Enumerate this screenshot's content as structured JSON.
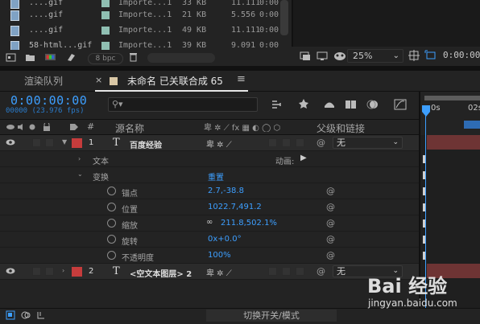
{
  "project": {
    "files": [
      {
        "name": "....gif",
        "type": "Importe...1",
        "size": "33 KB",
        "duration": "11.111",
        "extra": "0:00"
      },
      {
        "name": "....gif",
        "type": "Importe...1",
        "size": "21 KB",
        "duration": "5.556",
        "extra": "0:00"
      },
      {
        "name": "....gif",
        "type": "Importe...1",
        "size": "49 KB",
        "duration": "11.111",
        "extra": "0:00"
      },
      {
        "name": "58-html...gif",
        "type": "Importe...1",
        "size": "39 KB",
        "duration": "9.091",
        "extra": "0:00"
      }
    ],
    "bpc": "8 bpc"
  },
  "viewer": {
    "zoom": "25%",
    "time": "0:00:00:"
  },
  "tabs": {
    "render_queue": "渲染队列",
    "comp_name": "未命名 已关联合成 65"
  },
  "controls": {
    "timecode": "0:00:00:00",
    "fps": "00000 (23.976 fps)"
  },
  "header": {
    "index": "#",
    "source_name": "源名称",
    "parent": "父级和链接"
  },
  "layers": [
    {
      "index": "1",
      "type_glyph": "T",
      "name": "百度经验",
      "parent": "无"
    },
    {
      "index": "2",
      "type_glyph": "T",
      "name": "<空文本图层> 2",
      "parent": "无"
    }
  ],
  "props": {
    "text": "文本",
    "animate": "动画:",
    "transform": "变换",
    "reset": "重置",
    "anchor": {
      "label": "锚点",
      "value": "2.7,-38.8"
    },
    "position": {
      "label": "位置",
      "value": "1022.7,491.2"
    },
    "scale": {
      "label": "缩放",
      "value": "211.8,502.1%"
    },
    "rotation": {
      "label": "旋转",
      "value": "0x+0.0°"
    },
    "opacity": {
      "label": "不透明度",
      "value": "100%"
    }
  },
  "ruler": {
    "t0": "0s",
    "t1": "02s"
  },
  "bottom": {
    "toggle": "切换开关/模式"
  },
  "watermark": {
    "line1": "Bai 经验",
    "line2": "jingyan.baidu.com"
  },
  "colors": {
    "accent": "#3d9fff",
    "label_red": "#c63c3c",
    "bar_red": "#6e3434"
  }
}
